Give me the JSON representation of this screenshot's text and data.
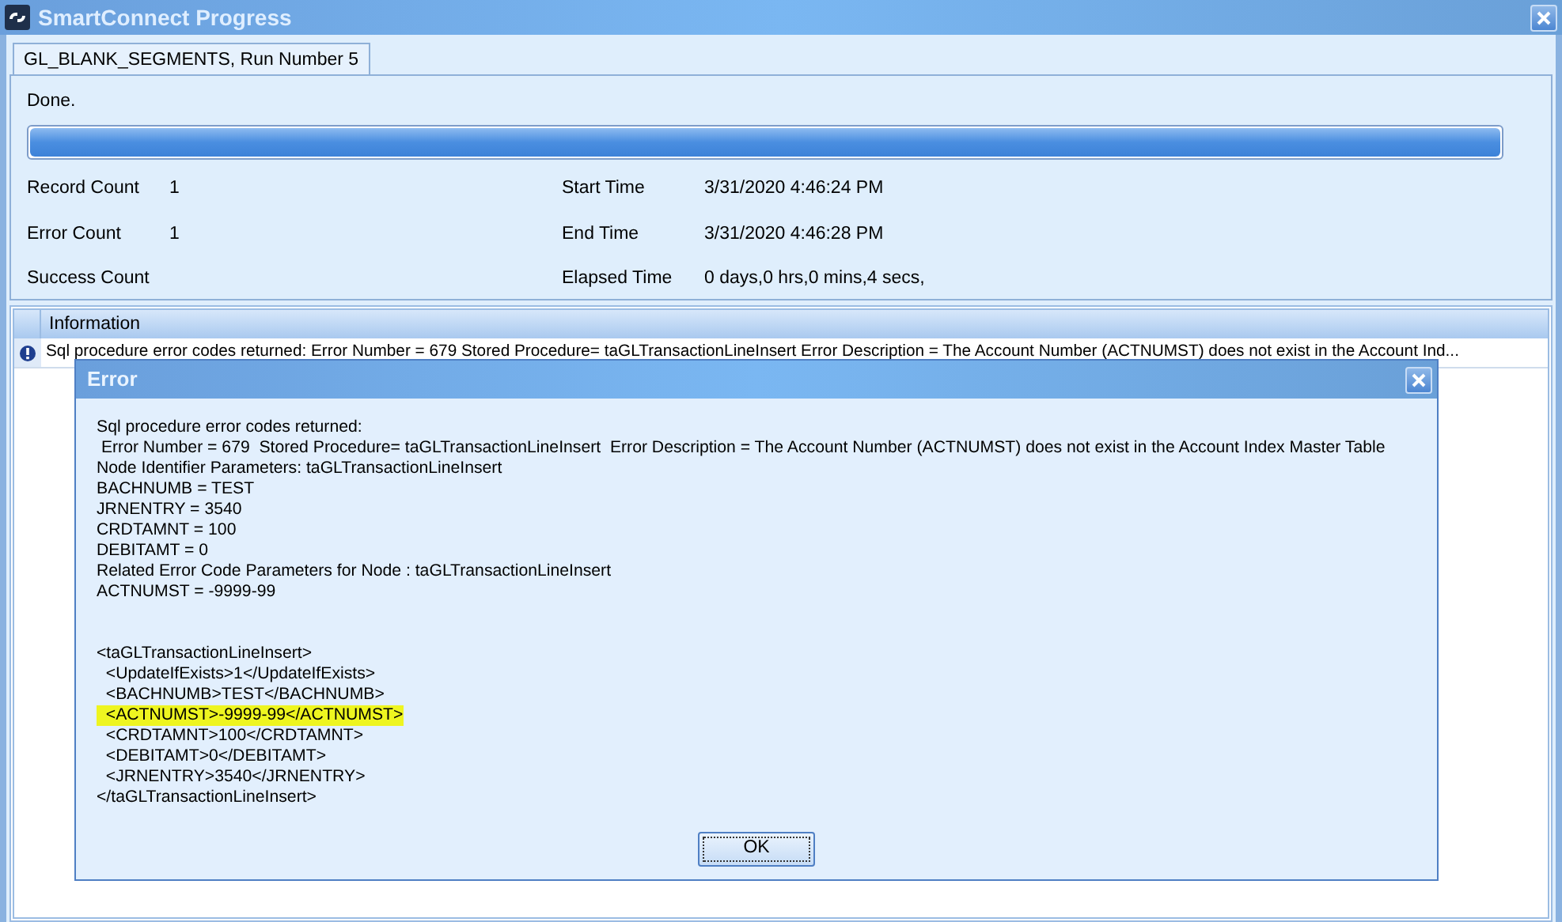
{
  "window": {
    "title": "SmartConnect Progress"
  },
  "tabs": [
    {
      "label": "GL_BLANK_SEGMENTS, Run Number 5",
      "selected": true
    }
  ],
  "status": "Done.",
  "progress": {
    "level": 1
  },
  "stats": [
    {
      "label": "Record Count",
      "value": "1"
    },
    {
      "label": "Start Time",
      "value": "3/31/2020 4:46:24 PM"
    },
    {
      "label": "Error Count",
      "value": "1"
    },
    {
      "label": "End Time",
      "value": "3/31/2020 4:46:28 PM"
    },
    {
      "label": "Success Count"
    },
    {
      "label": "Elapsed Time",
      "value": "0 days,0 hrs,0 mins,4 secs,"
    }
  ],
  "grid": {
    "columns": [
      "Information"
    ],
    "rows": [
      {
        "text": "Sql procedure error codes returned:  Error Number = 679  Stored Procedure= taGLTransactionLineInsert  Error Description = The Account Number (ACTNUMST) does not exist in the Account Ind..."
      }
    ]
  },
  "dialog": {
    "title": "Error",
    "message_lines": [
      "Sql procedure error codes returned:",
      " Error Number = 679  Stored Procedure= taGLTransactionLineInsert  Error Description = The Account Number (ACTNUMST) does not exist in the Account Index Master Table",
      "Node Identifier Parameters: taGLTransactionLineInsert",
      "BACHNUMB = TEST",
      "JRNENTRY = 3540",
      "CRDTAMNT = 100",
      "DEBITAMT = 0",
      "Related Error Code Parameters for Node : taGLTransactionLineInsert",
      "ACTNUMST = -9999-99"
    ],
    "xml_lines": [
      {
        "text": "<taGLTransactionLineInsert>",
        "highlighted": false
      },
      {
        "text": "  <UpdateIfExists>1</UpdateIfExists>",
        "highlighted": false
      },
      {
        "text": "  <BACHNUMB>TEST</BACHNUMB>",
        "highlighted": false
      },
      {
        "text": "  <ACTNUMST>-9999-99</ACTNUMST>",
        "highlighted": true
      },
      {
        "text": "  <CRDTAMNT>100</CRDTAMNT>",
        "highlighted": false
      },
      {
        "text": "  <DEBITAMT>0</DEBITAMT>",
        "highlighted": false
      },
      {
        "text": "  <JRNENTRY>3540</JRNENTRY>",
        "highlighted": false
      },
      {
        "text": "</taGLTransactionLineInsert>",
        "highlighted": false
      }
    ],
    "buttons": [
      "OK"
    ]
  }
}
